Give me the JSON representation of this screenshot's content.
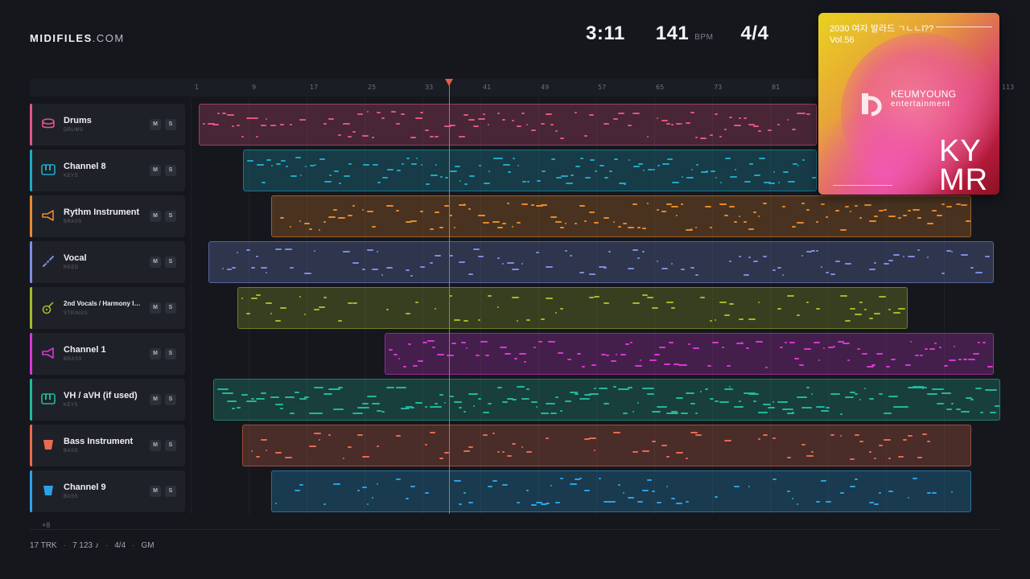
{
  "brand": {
    "name": "MIDIFILES",
    "domain": ".COM"
  },
  "transport": {
    "time": "3:11",
    "tempo": "141",
    "tempo_unit": "BPM",
    "signature": "4/4"
  },
  "ruler": {
    "ticks": [
      "1",
      "9",
      "17",
      "25",
      "33",
      "41",
      "49",
      "57",
      "65",
      "73",
      "81",
      "113"
    ]
  },
  "tracks": [
    {
      "name": "Drums",
      "type": "DRUMS",
      "mute": "M",
      "solo": "S",
      "color": "#e25584",
      "icon": "drum-icon"
    },
    {
      "name": "Channel 8",
      "type": "KEYS",
      "mute": "M",
      "solo": "S",
      "color": "#1fa9c6",
      "icon": "piano-icon"
    },
    {
      "name": "Rythm Instrument",
      "type": "BRASS",
      "mute": "M",
      "solo": "S",
      "color": "#e8892c",
      "icon": "horn-icon"
    },
    {
      "name": "Vocal",
      "type": "REED",
      "mute": "M",
      "solo": "S",
      "color": "#7b8ee0",
      "icon": "flute-icon"
    },
    {
      "name": "2nd Vocals / Harmony Ins...",
      "type": "STRINGS",
      "mute": "M",
      "solo": "S",
      "color": "#a4b82a",
      "icon": "guitar-icon"
    },
    {
      "name": "Channel 1",
      "type": "BRASS",
      "mute": "M",
      "solo": "S",
      "color": "#d936d6",
      "icon": "horn-icon"
    },
    {
      "name": "VH / aVH (if used)",
      "type": "KEYS",
      "mute": "M",
      "solo": "S",
      "color": "#22b89c",
      "icon": "piano-icon"
    },
    {
      "name": "Bass Instrument",
      "type": "BASS",
      "mute": "M",
      "solo": "S",
      "color": "#ea6a4f",
      "icon": "bass-icon"
    },
    {
      "name": "Channel 9",
      "type": "BASS",
      "mute": "M",
      "solo": "S",
      "color": "#2ba2e6",
      "icon": "bass-icon"
    }
  ],
  "more_tracks": "+8",
  "footer": {
    "tracks": "17 TRK",
    "notes": "7 123 ♪",
    "signature": "4/4",
    "standard": "GM"
  },
  "cover": {
    "title": "2030 여자 발라드 ㄱㄴㄴl??",
    "volume": "Vol.56",
    "label": "KEUMYOUNG",
    "label_sub": "entertainment",
    "mark_line1": "KY",
    "mark_line2": "MR"
  }
}
